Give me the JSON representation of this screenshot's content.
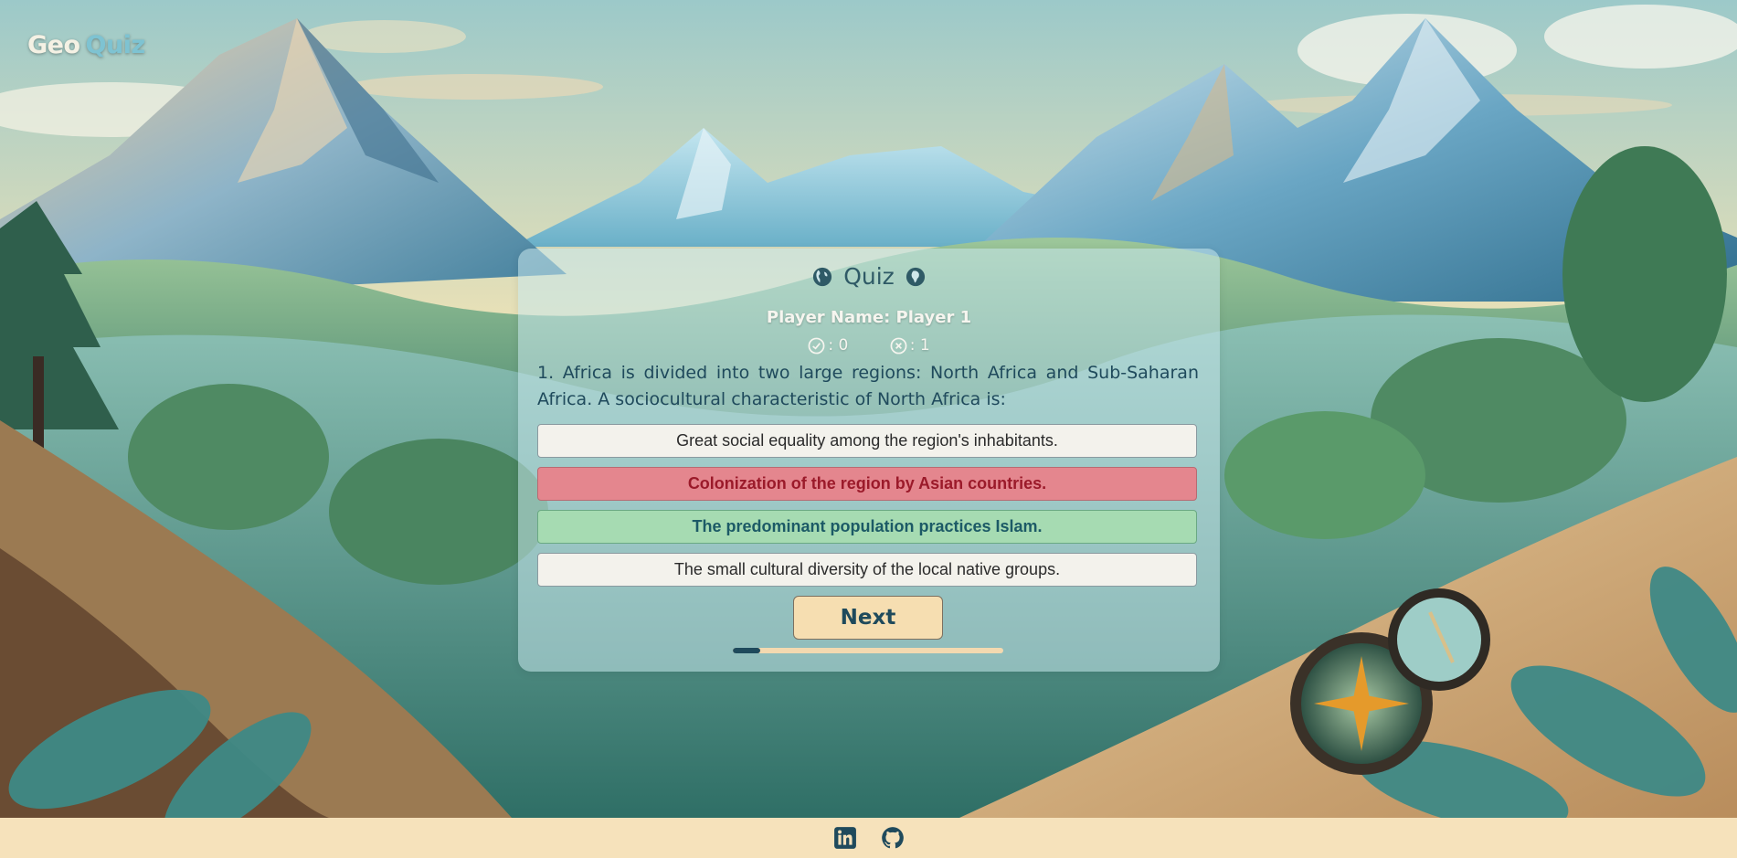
{
  "logo": {
    "part1": "Geo",
    "part2": "Quiz"
  },
  "quiz": {
    "title": "Quiz",
    "player_label": "Player Name: Player 1",
    "correct_count": ": 0",
    "wrong_count": ": 1",
    "question": "1. Africa is divided into two large regions: North Africa and Sub-Saharan Africa. A sociocultural characteristic of North Africa is:",
    "answers": [
      {
        "text": "Great social equality among the region's inhabitants.",
        "state": "neutral"
      },
      {
        "text": "Colonization of the region by Asian countries.",
        "state": "wrong"
      },
      {
        "text": "The predominant population practices Islam.",
        "state": "correct"
      },
      {
        "text": "The small cultural diversity of the local native groups.",
        "state": "neutral"
      }
    ],
    "next_label": "Next",
    "progress_fraction": 0.1
  },
  "colors": {
    "primary": "#1f4a5c",
    "correct": "#a6dbb2",
    "wrong": "#e4868e",
    "footer": "#f6e2bb",
    "button": "#f6deb1"
  },
  "footer": {
    "icons": [
      "linkedin-icon",
      "github-icon"
    ]
  }
}
